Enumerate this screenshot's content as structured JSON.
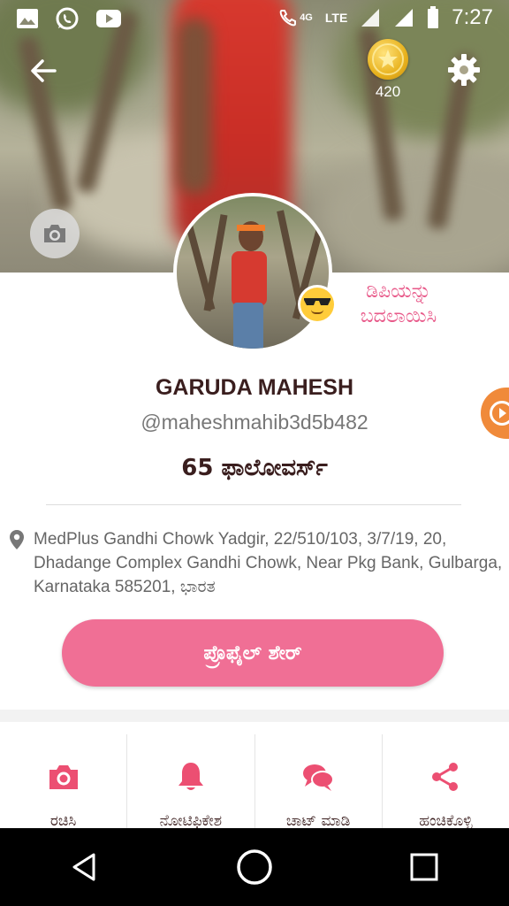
{
  "status_bar": {
    "icons": [
      "image-icon",
      "whatsapp-icon",
      "youtube-icon"
    ],
    "network": "LTE",
    "network_small": "4G",
    "time": "7:27"
  },
  "header": {
    "coin_count": "420"
  },
  "profile": {
    "change_dp_label": "ಡಿಪಿಯನ್ನು ಬದಲಾಯಿಸಿ",
    "name": "GARUDA MAHESH",
    "handle": "@maheshmahib3d5b482",
    "followers": "65 ಫಾಲೋವರ್ಸ್",
    "address": "MedPlus Gandhi Chowk Yadgir, 22/510/103, 3/7/19, 20, Dhadange Complex Gandhi Chowk, Near Pkg Bank, Gulbarga, Karnataka 585201, ಭಾರತ",
    "share_button": "ಪ್ರೊಫೈಲ್ ಶೇರ್"
  },
  "actions": [
    {
      "label": "ರಚಿಸಿ",
      "icon": "camera-icon"
    },
    {
      "label": "ನೋಟಿಫಿಕೇಶ",
      "icon": "bell-icon"
    },
    {
      "label": "ಚಾಟ್ ಮಾಡಿ",
      "icon": "chat-icon"
    },
    {
      "label": "ಹಂಚಿಕೊಳ್ಳಿ",
      "icon": "share-icon"
    }
  ],
  "colors": {
    "accent": "#f06f95",
    "text_dark": "#3a1e1e",
    "nav_bar": "#000000"
  }
}
